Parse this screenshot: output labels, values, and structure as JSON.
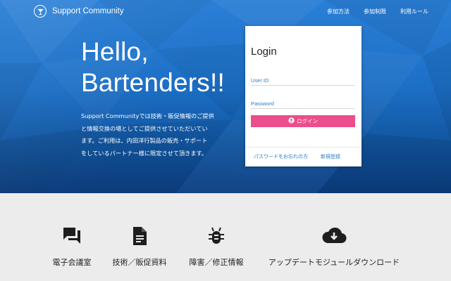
{
  "brand": {
    "name": "Support Community",
    "logo_icon": "cocktail-glass-icon"
  },
  "nav": {
    "items": [
      "参加方法",
      "参加制限",
      "利用ルール"
    ]
  },
  "hero": {
    "headline_line1": "Hello,",
    "headline_line2": "Bartenders!!",
    "intro_lines": [
      "Support Communityでは技術・販促情報のご提供",
      "と情報交換の場としてご提供させていただいてい",
      "ます。ご利用は、内田洋行製品の販売・サポート",
      "をしているパートナー様に限定させて頂きます。"
    ]
  },
  "login": {
    "title": "Login",
    "user_placeholder": "User ID",
    "password_placeholder": "Password",
    "button_label": "ログイン",
    "button_icon": "user-circle-icon",
    "forgot_link": "パスワードをお忘れの方",
    "register_link": "新規登録"
  },
  "features": [
    {
      "label": "電子会議室",
      "icon": "forum-icon"
    },
    {
      "label": "技術／販促資料",
      "icon": "document-icon"
    },
    {
      "label": "障害／修正情報",
      "icon": "bug-icon"
    },
    {
      "label": "アップデートモジュールダウンロード",
      "icon": "cloud-download-icon"
    }
  ],
  "colors": {
    "hero_top": "#2a7fd6",
    "hero_bottom": "#0c3f82",
    "button": "#ec4d8b",
    "link": "#2b7cc8",
    "band": "#ececec"
  }
}
